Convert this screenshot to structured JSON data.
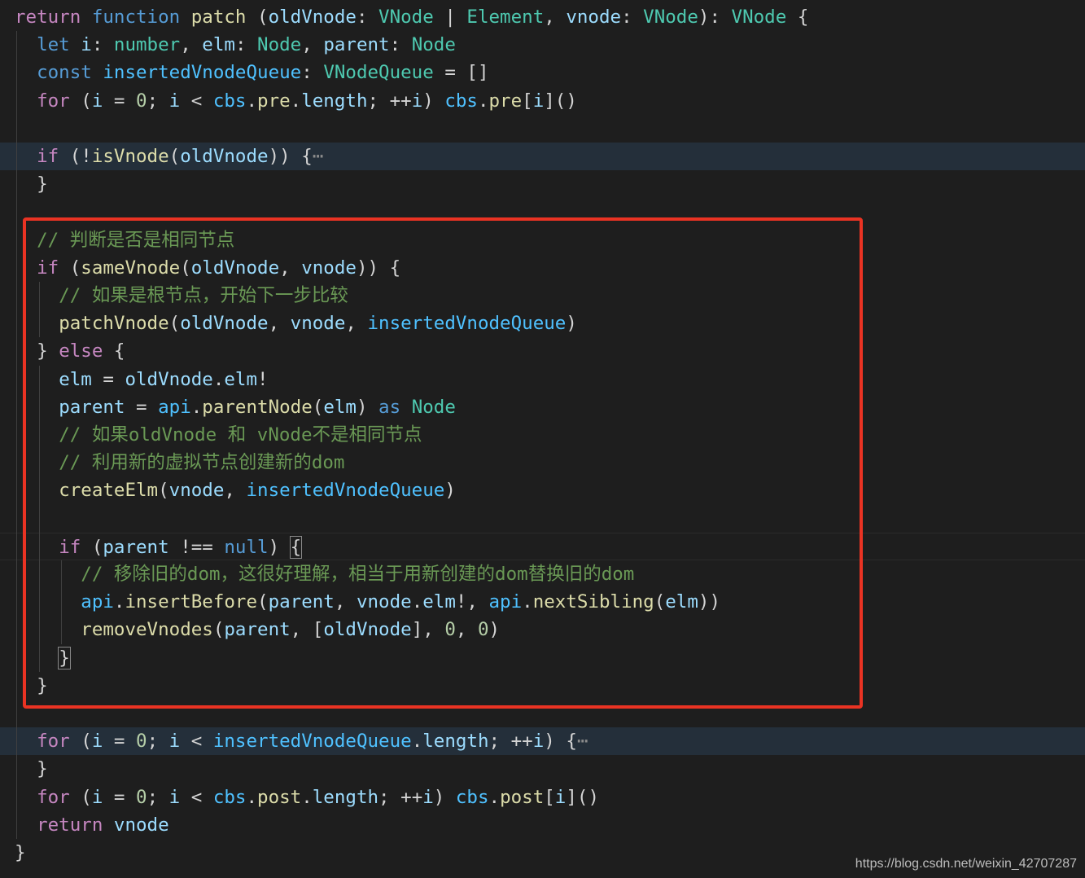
{
  "editor": {
    "theme_colors": {
      "background": "#1e1e1e",
      "keyword": "#569cd6",
      "control": "#c586c0",
      "function": "#dcdcaa",
      "variable": "#9cdcfe",
      "constant": "#4fc1ff",
      "type": "#4ec9b0",
      "number": "#b5cea8",
      "comment": "#6a9955",
      "highlight_box": "#ea3323"
    },
    "lines": [
      "return function patch (oldVnode: VNode | Element, vnode: VNode): VNode {",
      "  let i: number, elm: Node, parent: Node",
      "  const insertedVnodeQueue: VNodeQueue = []",
      "  for (i = 0; i < cbs.pre.length; ++i) cbs.pre[i]()",
      "",
      "  if (!isVnode(oldVnode)) {",
      "  }",
      "",
      "  // 判断是否是相同节点",
      "  if (sameVnode(oldVnode, vnode)) {",
      "    // 如果是根节点，开始下一步比较",
      "    patchVnode(oldVnode, vnode, insertedVnodeQueue)",
      "  } else {",
      "    elm = oldVnode.elm!",
      "    parent = api.parentNode(elm) as Node",
      "    // 如果oldVnode 和 vNode不是相同节点",
      "    // 利用新的虚拟节点创建新的dom",
      "    createElm(vnode, insertedVnodeQueue)",
      "",
      "    if (parent !== null) {",
      "      // 移除旧的dom，这很好理解，相当于用新创建的dom替换旧的dom",
      "      api.insertBefore(parent, vnode.elm!, api.nextSibling(elm))",
      "      removeVnodes(parent, [oldVnode], 0, 0)",
      "    }",
      "  }",
      "",
      "  for (i = 0; i < insertedVnodeQueue.length; ++i) {",
      "  }",
      "  for (i = 0; i < cbs.post.length; ++i) cbs.post[i]()",
      "  return vnode",
      "}"
    ],
    "fold_ellipsis": "⋯"
  },
  "watermark": "https://blog.csdn.net/weixin_42707287"
}
